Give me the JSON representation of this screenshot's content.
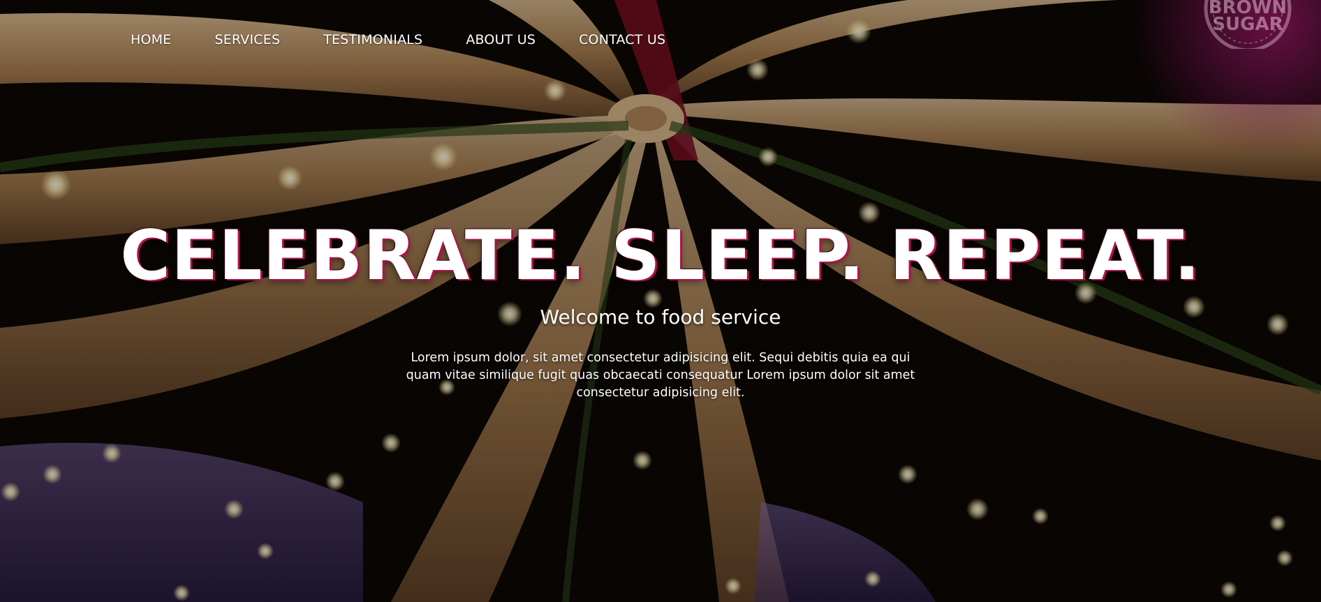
{
  "nav": {
    "items": [
      {
        "label": "HOME"
      },
      {
        "label": "SERVICES"
      },
      {
        "label": "TESTIMONIALS"
      },
      {
        "label": "ABOUT US"
      },
      {
        "label": "CONTACT US"
      }
    ]
  },
  "logo": {
    "line1": "BROWN",
    "line2": "SUGAR"
  },
  "hero": {
    "headline": "CELEBRATE. SLEEP. REPEAT.",
    "subtitle": "Welcome to food service",
    "description": "Lorem ipsum dolor, sit amet consectetur adipisicing elit. Sequi debitis quia ea qui quam vitae similique fugit quas obcaecati consequatur Lorem ipsum dolor sit amet consectetur adipisicing elit."
  },
  "colors": {
    "accent": "#b0124a",
    "text": "#ffffff",
    "logo_glow": "#8a1a5a"
  }
}
